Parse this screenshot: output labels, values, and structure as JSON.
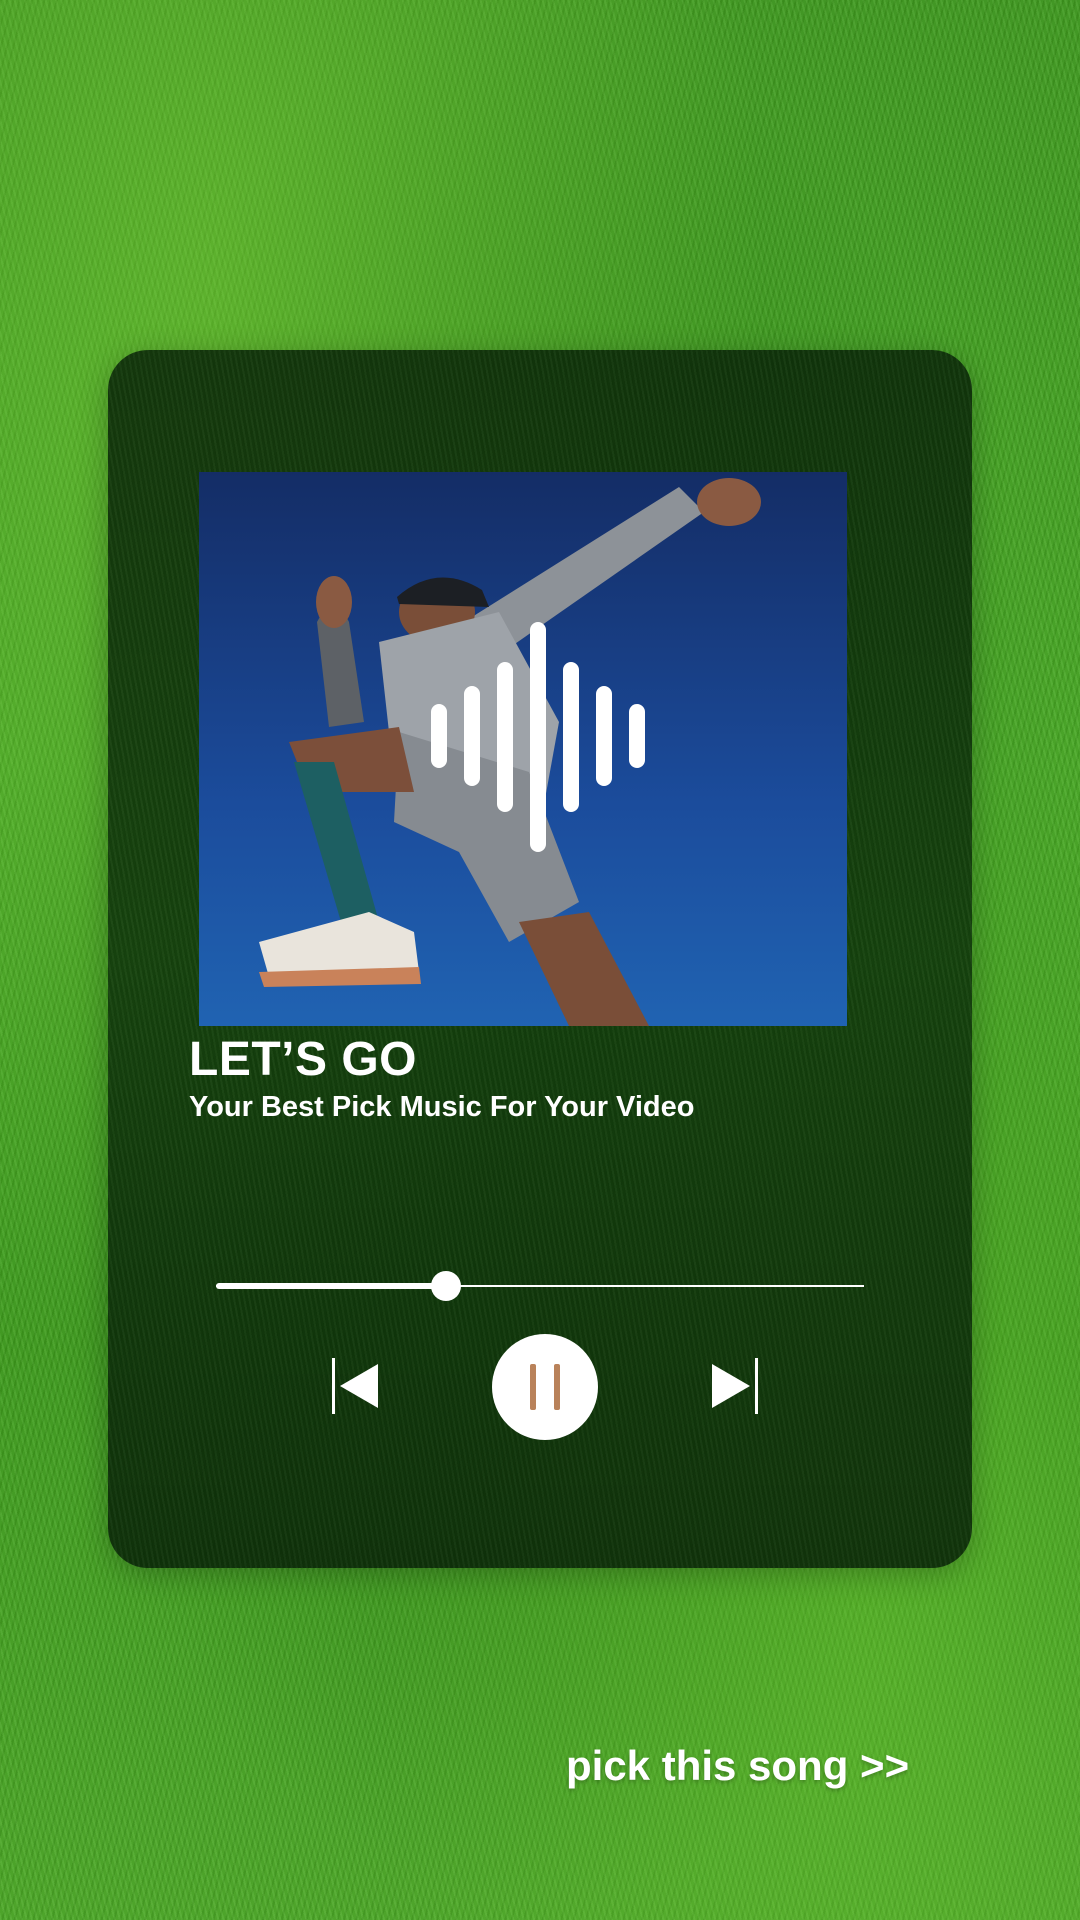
{
  "player": {
    "title": "LET’S GO",
    "subtitle": "Your Best Pick Music For Your Video",
    "progress_fraction": 0.355,
    "state": "playing"
  },
  "controls": {
    "previous_icon": "skip-previous-icon",
    "play_pause_icon": "pause-icon",
    "next_icon": "skip-next-icon"
  },
  "album_art": {
    "overlay_icon": "sound-wave-icon"
  },
  "cta": {
    "label": "pick this song >>"
  },
  "colors": {
    "card_bg": "#0f3a0b",
    "text": "#ffffff",
    "pause_accent": "#b9825a",
    "sky": "#1a4a9a"
  }
}
